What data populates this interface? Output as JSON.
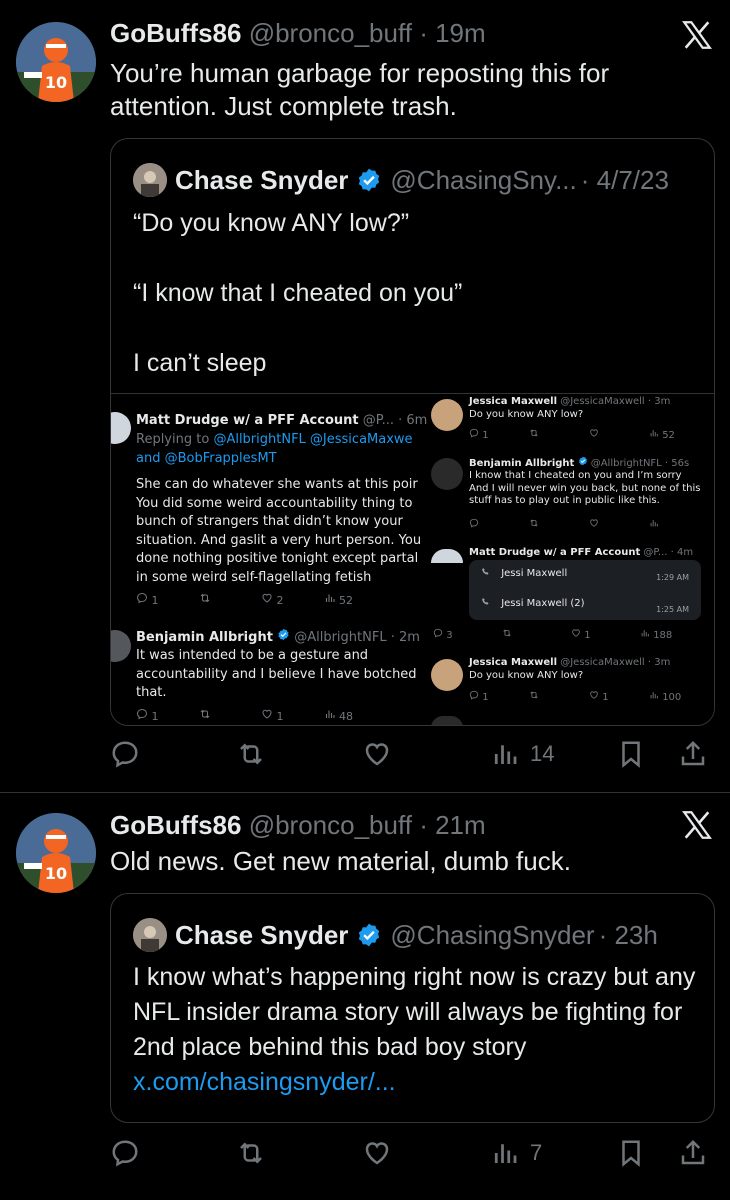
{
  "tweets": [
    {
      "username": "GoBuffs86",
      "handle": "@bronco_buff",
      "time": "· 19m",
      "text": "You’re human garbage for reposting this for attention. Just complete trash.",
      "quote": {
        "name": "Chase Snyder",
        "handle": "@ChasingSny...",
        "time": "· 4/7/23",
        "text": "“Do you know ANY low?”\n\n“I know that I cheated on you”\n\nI can’t sleep"
      },
      "views": "14"
    },
    {
      "username": "GoBuffs86",
      "handle": "@bronco_buff",
      "time": "· 21m",
      "text": "Old news. Get new material, dumb fuck.",
      "quote": {
        "name": "Chase Snyder",
        "handle": "@ChasingSnyder",
        "time": "· 23h",
        "text": "I know what’s happening right now is crazy but any NFL insider drama story will always be fighting for 2nd place behind this bad boy story",
        "link": "x.com/chasingsnyder/..."
      },
      "views": "7"
    }
  ],
  "media": {
    "left": {
      "post1": {
        "name": "Matt Drudge w/ a PFF Account",
        "handle": "@P... · 6m",
        "replying": "Replying to",
        "mentions1": "@AllbrightNFL @JessicaMaxwe",
        "mentions2": "and @BobFrapplesMT",
        "lines": [
          "She can do whatever she wants at this poir",
          "You did some weird accountability thing to",
          "bunch of strangers that didn’t know your",
          "situation. And gaslit a very hurt person. You",
          "done nothing positive tonight except partal",
          "in some weird self-flagellating fetish"
        ],
        "stats": [
          "1",
          "",
          "2",
          "52"
        ]
      },
      "post2": {
        "name": "Benjamin Allbright",
        "handle": "@AllbrightNFL · 2m",
        "lines": [
          "It was intended to be a gesture and",
          "accountability and I believe I have botched",
          "that."
        ],
        "stats": [
          "1",
          "",
          "1",
          "48"
        ]
      }
    },
    "right": {
      "post1": {
        "name": "Jessica Maxwell",
        "handle": "@JessicaMaxwell · 3m",
        "text": "Do you know ANY low?",
        "stats": [
          "1",
          "",
          "",
          "52"
        ]
      },
      "post2": {
        "name": "Benjamin Allbright",
        "handle": "@AllbrightNFL · 56s",
        "lines": [
          "I know that I cheated on you and I’m sorry",
          "And I will never win you back, but none of this",
          "stuff has to play out in public like this."
        ]
      },
      "post3": {
        "name": "Matt Drudge w/ a PFF Account",
        "handle": "@P... · 4m",
        "call1": "Jessi Maxwell",
        "call1_time": "1:29 AM",
        "call2": "Jessi Maxwell (2)",
        "call2_time": "1:25 AM",
        "stats": [
          "3",
          "",
          "1",
          "188"
        ]
      },
      "post4": {
        "name": "Jessica Maxwell",
        "handle": "@JessicaMaxwell · 3m",
        "text": "Do you know ANY low?",
        "stats": [
          "1",
          "",
          "1",
          "100"
        ]
      }
    }
  },
  "icons": [
    "reply-icon",
    "repost-icon",
    "like-icon",
    "views-icon",
    "bookmark-icon",
    "share-icon",
    "x-logo-icon",
    "verified-icon"
  ],
  "colors": {
    "accent": "#1d9bf0",
    "muted": "#71767b",
    "text": "#e7e9ea",
    "background": "#000000"
  }
}
